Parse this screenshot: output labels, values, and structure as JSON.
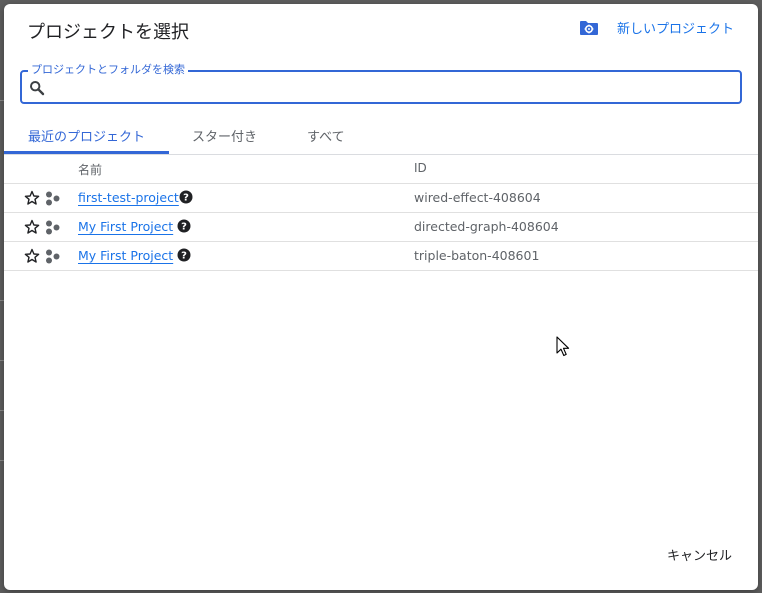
{
  "dialog": {
    "title": "プロジェクトを選択",
    "new_project_label": "新しいプロジェクト",
    "new_project_icon": "folder-gear-icon",
    "cancel_label": "キャンセル"
  },
  "search": {
    "label": "プロジェクトとフォルダを検索",
    "value": "",
    "placeholder": ""
  },
  "tabs": [
    {
      "label": "最近のプロジェクト",
      "active": true
    },
    {
      "label": "スター付き",
      "active": false
    },
    {
      "label": "すべて",
      "active": false
    }
  ],
  "table": {
    "headers": {
      "name": "名前",
      "id": "ID"
    },
    "rows": [
      {
        "name": "first-test-project",
        "id": "wired-effect-408604"
      },
      {
        "name": "My First Project",
        "id": "directed-graph-408604"
      },
      {
        "name": "My First Project",
        "id": "triple-baton-408601"
      }
    ]
  },
  "colors": {
    "accent": "#3367d6",
    "link": "#1a73e8"
  }
}
